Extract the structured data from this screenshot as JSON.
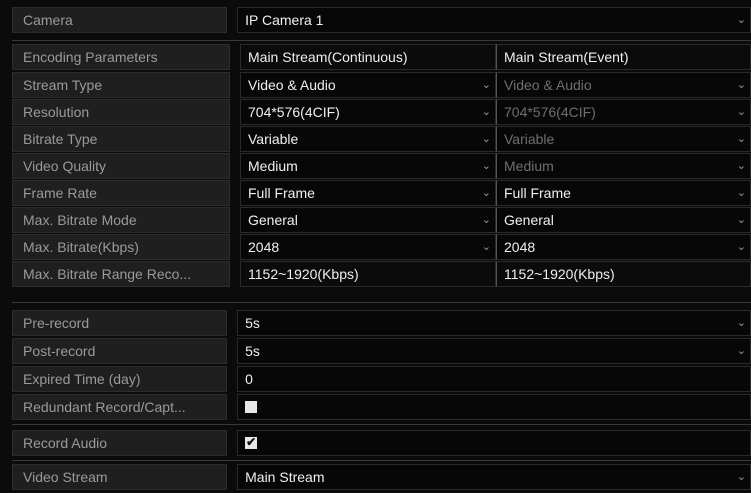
{
  "camera": {
    "label": "Camera",
    "value": "IP Camera 1"
  },
  "encoding": {
    "header_label": "Encoding Parameters",
    "col_main": "Main Stream(Continuous)",
    "col_event": "Main Stream(Event)",
    "rows": [
      {
        "label": "Stream Type",
        "main": "Video & Audio",
        "event": "Video & Audio",
        "event_disabled": true
      },
      {
        "label": "Resolution",
        "main": "704*576(4CIF)",
        "event": "704*576(4CIF)",
        "event_disabled": true
      },
      {
        "label": "Bitrate Type",
        "main": "Variable",
        "event": "Variable",
        "event_disabled": true
      },
      {
        "label": "Video Quality",
        "main": "Medium",
        "event": "Medium",
        "event_disabled": true
      },
      {
        "label": "Frame Rate",
        "main": "Full Frame",
        "event": "Full Frame",
        "event_disabled": false
      },
      {
        "label": "Max. Bitrate Mode",
        "main": "General",
        "event": "General",
        "event_disabled": false
      },
      {
        "label": "Max. Bitrate(Kbps)",
        "main": "2048",
        "event": "2048",
        "event_disabled": false
      },
      {
        "label": "Max. Bitrate Range Reco...",
        "main": "1152~1920(Kbps)",
        "event": "1152~1920(Kbps)",
        "event_disabled": false
      }
    ]
  },
  "record": {
    "pre_record": {
      "label": "Pre-record",
      "value": "5s"
    },
    "post_record": {
      "label": "Post-record",
      "value": "5s"
    },
    "expired_time": {
      "label": "Expired Time (day)",
      "value": "0"
    },
    "redundant": {
      "label": "Redundant Record/Capt...",
      "checked": false
    },
    "record_audio": {
      "label": "Record Audio",
      "checked": true
    }
  },
  "video_stream": {
    "label": "Video Stream",
    "value": "Main Stream"
  },
  "glyphs": {
    "caret": "⌄",
    "tick": "✔"
  },
  "colors": {
    "background": "#0b0b0b",
    "label_bg": "#1f1f1f",
    "field_bg": "#070707",
    "disabled_text": "#6f6f6f"
  }
}
